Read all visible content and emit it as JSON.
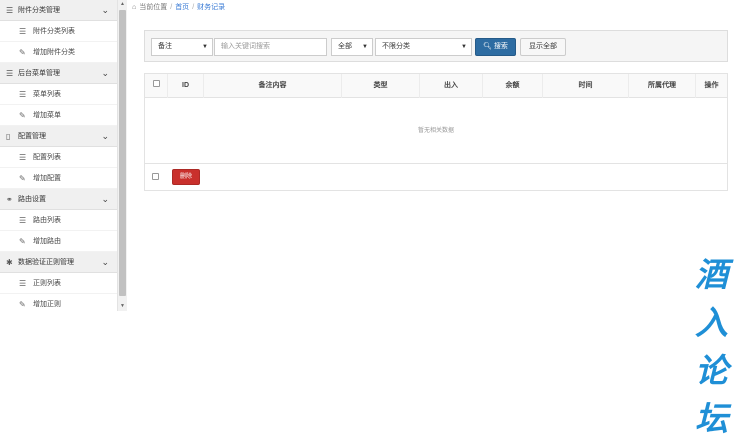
{
  "sidebar": {
    "groups": [
      {
        "title": "附件分类管理",
        "icon": "list-icon",
        "items": [
          {
            "label": "附件分类列表",
            "icon": "list-icon"
          },
          {
            "label": "增加附件分类",
            "icon": "pencil-icon"
          }
        ]
      },
      {
        "title": "后台菜单管理",
        "icon": "list-icon",
        "items": [
          {
            "label": "菜单列表",
            "icon": "list-icon"
          },
          {
            "label": "增加菜单",
            "icon": "pencil-icon"
          }
        ]
      },
      {
        "title": "配置管理",
        "icon": "document-icon",
        "items": [
          {
            "label": "配置列表",
            "icon": "list-icon"
          },
          {
            "label": "增加配置",
            "icon": "pencil-icon"
          }
        ]
      },
      {
        "title": "路由设置",
        "icon": "link-icon",
        "items": [
          {
            "label": "路由列表",
            "icon": "list-icon"
          },
          {
            "label": "增加路由",
            "icon": "pencil-icon"
          }
        ]
      },
      {
        "title": "数据验证正则管理",
        "icon": "asterisk-icon",
        "items": [
          {
            "label": "正则列表",
            "icon": "list-icon"
          },
          {
            "label": "增加正则",
            "icon": "pencil-icon"
          }
        ]
      }
    ]
  },
  "breadcrumb": {
    "prefix": "当前位置",
    "home": "首页",
    "current": "财务记录"
  },
  "filter": {
    "field_select": "备注",
    "search_placeholder": "输入关键词搜索",
    "status_select": "全部",
    "category_select": "不限分类",
    "search_button": "搜索",
    "show_all_button": "显示全部"
  },
  "table": {
    "columns": [
      "ID",
      "备注内容",
      "类型",
      "出入",
      "余额",
      "时间",
      "所属代理",
      "操作"
    ],
    "empty_text": "暂无相关数据",
    "delete_button": "删除"
  },
  "watermark": "酒入论坛",
  "colors": {
    "primary": "#2d6ca2",
    "danger": "#c9302c",
    "watermark": "#1f8fd6"
  }
}
